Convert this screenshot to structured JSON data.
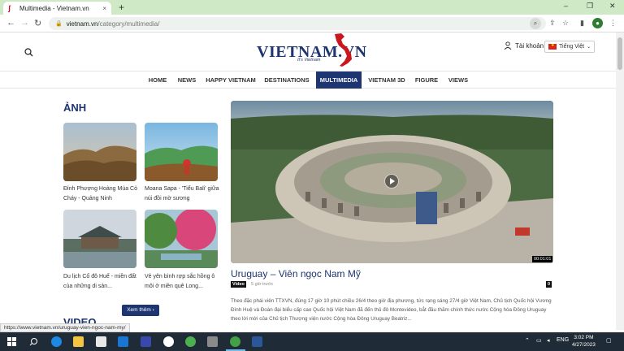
{
  "browser": {
    "tab_title": "Multimedia - Vietnam.vn",
    "tab_close": "×",
    "new_tab": "+",
    "url_host": "vietnam.vn",
    "url_path": "/category/multimedia/",
    "win_min": "–",
    "win_restore": "❐",
    "win_close": "✕",
    "status_url": "https://www.vietnam.vn/uruguay-vien-ngoc-nam-my/"
  },
  "header": {
    "logo": "VIETNAM.VN",
    "tagline": "It's Vietnam",
    "account_label": "Tài khoản",
    "language": "Tiếng Việt"
  },
  "menu": [
    {
      "label": "HOME",
      "active": false
    },
    {
      "label": "NEWS",
      "active": false
    },
    {
      "label": "HAPPY VIETNAM",
      "active": false
    },
    {
      "label": "DESTINATIONS",
      "active": false
    },
    {
      "label": "MULTIMEDIA",
      "active": true
    },
    {
      "label": "VIETNAM 3D",
      "active": false
    },
    {
      "label": "FIGURE",
      "active": false
    },
    {
      "label": "VIEWS",
      "active": false
    }
  ],
  "photos": {
    "title": "ẢNH",
    "items": [
      {
        "caption": "Đỉnh Phượng Hoàng Múa Cỏ Cháy - Quảng Ninh"
      },
      {
        "caption": "Moana Sapa - 'Tiểu Bali' giữa núi đồi mờ sương"
      },
      {
        "caption": "Du lịch Cố đô Huế - miền đất của những di sản..."
      },
      {
        "caption": "Vẻ yên bình rợp sắc hồng ô môi ở miền quê Long..."
      }
    ],
    "more_label": "Xem thêm ›"
  },
  "video_section_title": "VIDEO",
  "featured": {
    "duration": "00:01:01",
    "title": "Uruguay – Viên ngọc Nam Mỹ",
    "badge": "Video",
    "time_ago": "5 giờ trước",
    "count_badge": "0",
    "summary": "Theo đặc phái viên TTXVN, đúng 17 giờ 10 phút chiều 26/4 theo giờ địa phương, tức rạng sáng 27/4 giờ Việt Nam, Chủ tịch Quốc hội Vương Đình Huệ và Đoàn đại biểu cấp cao Quốc hội Việt Nam đã đến thủ đô Montevideo, bắt đầu thăm chính thức nước Cộng hòa Đông Uruguay theo lời mời của Chủ tịch Thượng viện nước Cộng hòa Đông Uruguay Beatriz..."
  },
  "taskbar": {
    "lang": "ENG",
    "time": "3:02 PM",
    "date": "4/27/2023"
  }
}
